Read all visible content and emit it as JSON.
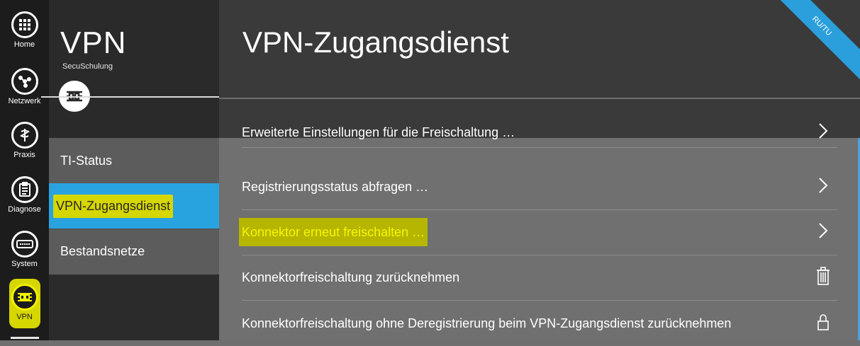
{
  "rail": {
    "items": [
      {
        "label": "Home",
        "icon": "grid-icon"
      },
      {
        "label": "Netzwerk",
        "icon": "network-icon"
      },
      {
        "label": "Praxis",
        "icon": "caduceus-icon"
      },
      {
        "label": "Diagnose",
        "icon": "clipboard-icon"
      },
      {
        "label": "System",
        "icon": "server-icon"
      },
      {
        "label": "VPN",
        "icon": "vpn-icon"
      }
    ]
  },
  "subnav": {
    "title": "VPN",
    "subtitle": "SecuSchulung",
    "items": [
      {
        "label": "TI-Status"
      },
      {
        "label": "VPN-Zugangsdienst"
      },
      {
        "label": "Bestandsnetze"
      }
    ]
  },
  "main": {
    "title": "VPN-Zugangsdienst",
    "ribbon": "RU/TU",
    "rows": [
      {
        "label": "Erweiterte Einstellungen für die Freischaltung …",
        "icon": "chevron-right-icon"
      },
      {
        "label": "Registrierungsstatus abfragen …",
        "icon": "chevron-right-icon"
      },
      {
        "label": "Konnektor erneut freischalten …",
        "icon": "chevron-right-icon"
      },
      {
        "label": "Konnektorfreischaltung zurücknehmen",
        "icon": "trash-icon"
      },
      {
        "label": "Konnektorfreischaltung ohne Deregistrierung beim VPN-Zugangsdienst zurücknehmen",
        "icon": "lock-icon"
      }
    ]
  },
  "colors": {
    "accent": "#29a3e0",
    "highlight": "#d6d600",
    "rail_bg": "#1c1c1c"
  }
}
